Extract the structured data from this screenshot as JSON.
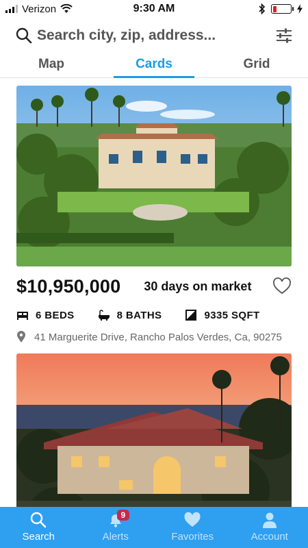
{
  "status_bar": {
    "carrier": "Verizon",
    "time": "9:30 AM"
  },
  "search": {
    "placeholder": "Search city, zip, address..."
  },
  "tabs": [
    {
      "label": "Map",
      "active": false
    },
    {
      "label": "Cards",
      "active": true
    },
    {
      "label": "Grid",
      "active": false
    }
  ],
  "listings": [
    {
      "price": "$10,950,000",
      "days_on_market": "30 days on market",
      "beds": "6 BEDS",
      "baths": "8 BATHS",
      "sqft": "9335 SQFT",
      "address": "41 Marguerite Drive, Rancho Palos Verdes, Ca, 90275"
    },
    {}
  ],
  "bottom_nav": [
    {
      "label": "Search",
      "icon": "search-icon",
      "active": true
    },
    {
      "label": "Alerts",
      "icon": "bell-icon",
      "badge": "9"
    },
    {
      "label": "Favorites",
      "icon": "heart-icon"
    },
    {
      "label": "Account",
      "icon": "person-icon"
    }
  ],
  "colors": {
    "accent": "#1a9ce8",
    "nav_background": "#2f9ff0",
    "badge": "#c8294a",
    "battery_low": "#e0202a"
  }
}
